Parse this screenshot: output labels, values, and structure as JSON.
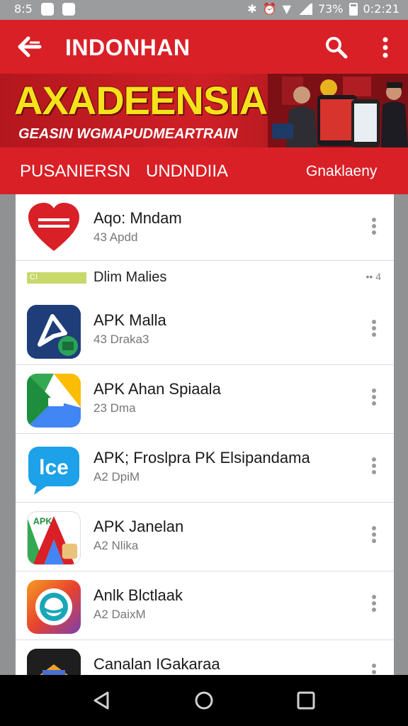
{
  "status_bar": {
    "left_text": "8:5",
    "battery": "73%",
    "time": "0:2:21"
  },
  "app_bar": {
    "title": "INDONHAN",
    "back_icon": "back-arrow-icon",
    "search_icon": "search-icon",
    "more_icon": "more-vert-icon"
  },
  "banner": {
    "headline": "AXADEENSIA",
    "subline": "GEASIN WGMAPUDMEARTRAIN"
  },
  "tabs": [
    {
      "label": "PUSANIERSN"
    },
    {
      "label": "UNDNDIIA"
    },
    {
      "label": "Gnaklaeny"
    }
  ],
  "list": {
    "first": {
      "name": "Aqo: Mndam",
      "meta": "43 Apdd"
    },
    "section": {
      "chip": "CI",
      "title": "Dlim Malies",
      "count": "4"
    },
    "items": [
      {
        "name": "APK Malla",
        "meta": "43 Draka3"
      },
      {
        "name": "APK Ahan Spiaala",
        "meta": "23 Dma"
      },
      {
        "name": "APK; Froslpra PK Elsipandama",
        "meta": "A2 DpiM"
      },
      {
        "name": "APK Janelan",
        "meta": "A2 Nlika"
      },
      {
        "name": "Anlk Blctlaak",
        "meta": "A2 DaixM"
      },
      {
        "name": "Canalan IGakaraa",
        "meta": ""
      }
    ]
  },
  "colors": {
    "accent": "#d92027",
    "banner_text": "#f5e21a"
  },
  "nav": {
    "back": "nav-back-icon",
    "home": "nav-home-icon",
    "recents": "nav-recents-icon"
  }
}
